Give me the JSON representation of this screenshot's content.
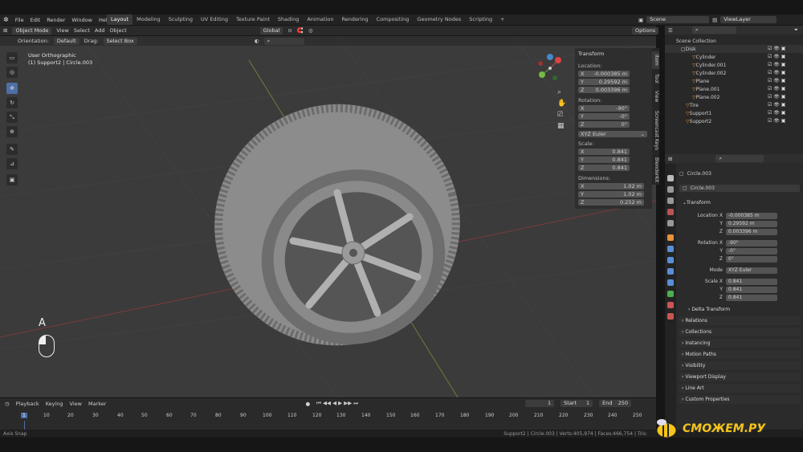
{
  "menu": {
    "items": [
      "File",
      "Edit",
      "Render",
      "Window",
      "Help"
    ]
  },
  "workspaces": [
    "Layout",
    "Modeling",
    "Sculpting",
    "UV Editing",
    "Texture Paint",
    "Shading",
    "Animation",
    "Rendering",
    "Compositing",
    "Geometry Nodes",
    "Scripting"
  ],
  "scene": "Scene",
  "view_layer": "ViewLayer",
  "header": {
    "mode": "Object Mode",
    "view": "View",
    "select": "Select",
    "add": "Add",
    "object": "Object",
    "orientation_label": "Orientation:",
    "orientation": "Default",
    "drag_label": "Drag:",
    "drag": "Select Box",
    "transform": "Global",
    "options": "Options"
  },
  "viewport": {
    "view_name": "User Orthographic",
    "object_info": "(1) Support2 | Circle.003",
    "key": "A"
  },
  "npanel": {
    "title": "Transform",
    "location_label": "Location:",
    "loc": [
      "-0.000385 m",
      "0.29592 m",
      "0.003396 m"
    ],
    "rotation_label": "Rotation:",
    "rot": [
      "-90°",
      "-0°",
      "0°"
    ],
    "rot_mode": "XYZ Euler",
    "scale_label": "Scale:",
    "scale": [
      "0.841",
      "0.841",
      "0.841"
    ],
    "dimensions_label": "Dimensions:",
    "dim": [
      "1.02 m",
      "1.02 m",
      "0.252 m"
    ],
    "axes": [
      "X",
      "Y",
      "Z"
    ]
  },
  "side_tabs": [
    "Item",
    "Tool",
    "View",
    "Screencast Keys",
    "BlenderKit"
  ],
  "outliner": {
    "root": "Scene Collection",
    "items": [
      "Disk",
      "Cylinder",
      "Cylinder.001",
      "Cylinder.002",
      "Plane",
      "Plane.001",
      "Plane.002",
      "Tire",
      "Support1",
      "Support2"
    ]
  },
  "properties": {
    "object": "Circle.003",
    "data": "Circle.003",
    "transform": "Transform",
    "loc_x": "Location X",
    "loc": [
      "-0.000385 m",
      "0.29592 m",
      "0.003396 m"
    ],
    "rot_x": "Rotation X",
    "rot": [
      "-90°",
      "-0°",
      "0°"
    ],
    "mode_label": "Mode",
    "mode": "XYZ Euler",
    "scale_x": "Scale X",
    "scale": [
      "0.841",
      "0.841",
      "0.841"
    ],
    "y": "Y",
    "z": "Z",
    "sections": [
      "Delta Transform",
      "Relations",
      "Collections",
      "Instancing",
      "Motion Paths",
      "Visibility",
      "Viewport Display",
      "Line Art",
      "Custom Properties"
    ]
  },
  "timeline": {
    "playback": "Playback",
    "keying": "Keying",
    "view": "View",
    "marker": "Marker",
    "frame": "1",
    "start_label": "Start",
    "start": "1",
    "end_label": "End",
    "end": "250",
    "ticks": [
      "1",
      "10",
      "20",
      "30",
      "40",
      "50",
      "60",
      "70",
      "80",
      "90",
      "100",
      "110",
      "120",
      "130",
      "140",
      "150",
      "160",
      "170",
      "180",
      "190",
      "200",
      "210",
      "220",
      "230",
      "240",
      "250"
    ]
  },
  "status": {
    "left": "Axis Snap",
    "right": "Support2 | Circle.003 | Verts:405,974 | Faces:466,754 | Tris:"
  },
  "watermark": "СМОЖЕМ.РУ"
}
